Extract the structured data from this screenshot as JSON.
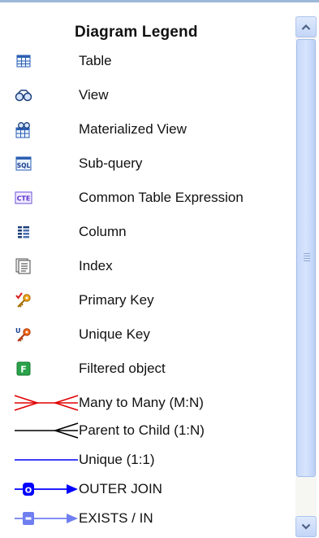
{
  "legend": {
    "title": "Diagram Legend",
    "objects": [
      {
        "label": "Table",
        "icon": "table-icon"
      },
      {
        "label": "View",
        "icon": "view-icon"
      },
      {
        "label": "Materialized View",
        "icon": "materialized-view-icon"
      },
      {
        "label": "Sub-query",
        "icon": "subquery-icon",
        "icon_text": "SQL"
      },
      {
        "label": "Common Table Expression",
        "icon": "cte-icon",
        "icon_text": "CTE"
      },
      {
        "label": "Column",
        "icon": "column-icon"
      },
      {
        "label": "Index",
        "icon": "index-icon"
      },
      {
        "label": "Primary Key",
        "icon": "primary-key-icon"
      },
      {
        "label": "Unique Key",
        "icon": "unique-key-icon",
        "icon_text": "U"
      },
      {
        "label": "Filtered object",
        "icon": "filtered-object-icon",
        "icon_text": "F"
      }
    ],
    "relations": [
      {
        "label": "Many to Many (M:N)",
        "icon": "many-to-many-line-icon",
        "color": "#e00000"
      },
      {
        "label": "Parent to Child (1:N)",
        "icon": "parent-child-line-icon",
        "color": "#000000"
      },
      {
        "label": "Unique (1:1)",
        "icon": "unique-line-icon",
        "color": "#0000ff"
      },
      {
        "label": "OUTER JOIN",
        "icon": "outer-join-line-icon",
        "color": "#0000ff",
        "icon_text": "O"
      },
      {
        "label": "EXISTS / IN",
        "icon": "exists-in-line-icon",
        "color": "#6f7ff0"
      }
    ]
  },
  "scrollbar": {
    "up_icon": "chevron-up-icon",
    "down_icon": "chevron-down-icon"
  }
}
